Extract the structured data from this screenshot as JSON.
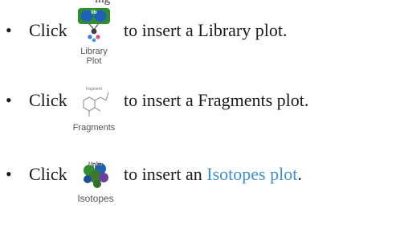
{
  "top_clip_text": "ing",
  "items": [
    {
      "bullet": "•",
      "click": "Click",
      "button": {
        "label_line1": "Library",
        "label_line2": "Plot",
        "icon": "library-plot-icon"
      },
      "desc_prefix": "to insert a ",
      "desc_link": "",
      "desc_rest": "Library plot."
    },
    {
      "bullet": "•",
      "click": "Click",
      "button": {
        "label_line1": "Fragments",
        "label_line2": "",
        "icon": "fragments-plot-icon"
      },
      "desc_prefix": "to insert a ",
      "desc_link": "",
      "desc_rest": "Fragments plot."
    },
    {
      "bullet": "•",
      "click": "Click",
      "button": {
        "label_line1": "Isotopes",
        "label_line2": "",
        "icon": "isotopes-plot-icon"
      },
      "desc_prefix": "to insert an ",
      "desc_link": "Isotopes plot",
      "desc_rest": "."
    }
  ],
  "colors": {
    "link": "#3f8fd2",
    "text": "#1a1a1a"
  }
}
